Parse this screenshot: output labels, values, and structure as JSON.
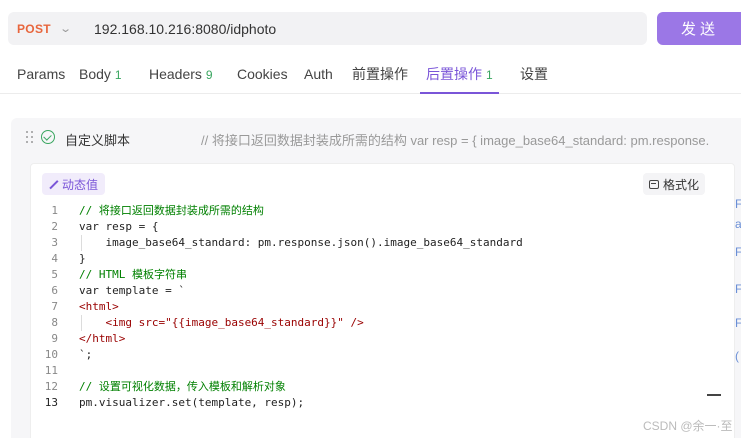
{
  "request": {
    "method": "POST",
    "url": "192.168.10.216:8080/idphoto",
    "send_label": "发送"
  },
  "tabs": [
    {
      "label": "Params",
      "count": ""
    },
    {
      "label": "Body",
      "count": "1"
    },
    {
      "label": "Headers",
      "count": "9"
    },
    {
      "label": "Cookies",
      "count": ""
    },
    {
      "label": "Auth",
      "count": ""
    },
    {
      "label": "前置操作",
      "count": ""
    },
    {
      "label": "后置操作",
      "count": "1",
      "active": true
    },
    {
      "label": "设置",
      "count": ""
    }
  ],
  "script": {
    "name": "自定义脚本",
    "summary": "// 将接口返回数据封装成所需的结构 var resp = { image_base64_standard: pm.response.",
    "dynamic_label": "动态值",
    "format_label": "格式化",
    "current_line": "13",
    "lines": [
      "// 将接口返回数据封装成所需的结构",
      "var resp = {",
      "    image_base64_standard: pm.response.json().image_base64_standard",
      "}",
      "// HTML 模板字符串",
      "var template = `",
      "<html>",
      "    <img src=\"{{image_base64_standard}}\" />",
      "</html>",
      "`;",
      "",
      "// 设置可视化数据，传入模板和解析对象",
      "pm.visualizer.set(template, resp);"
    ]
  },
  "watermark": "CSDN @余一·至"
}
